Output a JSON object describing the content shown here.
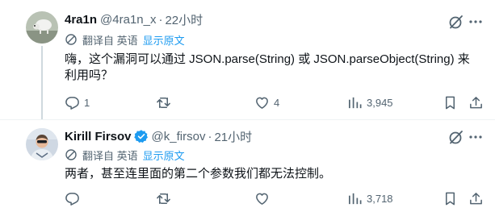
{
  "tweets": [
    {
      "name": "4ra1n",
      "handle": "@4ra1n_x",
      "separator": "·",
      "time": "22小时",
      "translated_from": "翻译自 英语",
      "show_original": "显示原文",
      "text": "嗨，这个漏洞可以通过 JSON.parse(String) 或 JSON.parseObject(String) 来利用吗？",
      "reply_count": "1",
      "retweet_count": "",
      "like_count": "4",
      "view_count": "3,945",
      "verified": false,
      "icons": [
        "avatar-image",
        "grok-icon",
        "more-icon",
        "translate-icon",
        "reply-icon",
        "retweet-icon",
        "like-icon",
        "views-icon",
        "bookmark-icon",
        "share-icon"
      ]
    },
    {
      "name": "Kirill Firsov",
      "handle": "@k_firsov",
      "separator": "·",
      "time": "21小时",
      "translated_from": "翻译自 英语",
      "show_original": "显示原文",
      "text": "两者，甚至连里面的第二个参数我们都无法控制。",
      "reply_count": "",
      "retweet_count": "",
      "like_count": "",
      "view_count": "3,718",
      "verified": true,
      "icons": [
        "avatar-image",
        "verified-badge-icon",
        "grok-icon",
        "more-icon",
        "translate-icon",
        "reply-icon",
        "retweet-icon",
        "like-icon",
        "views-icon",
        "bookmark-icon",
        "share-icon"
      ]
    }
  ],
  "colors": {
    "text_primary": "#0f1419",
    "text_secondary": "#536471",
    "link_blue": "#1d9bf0",
    "verified_blue": "#1d9bf0",
    "divider": "#eff3f4",
    "thread_line": "#cfd9de"
  }
}
